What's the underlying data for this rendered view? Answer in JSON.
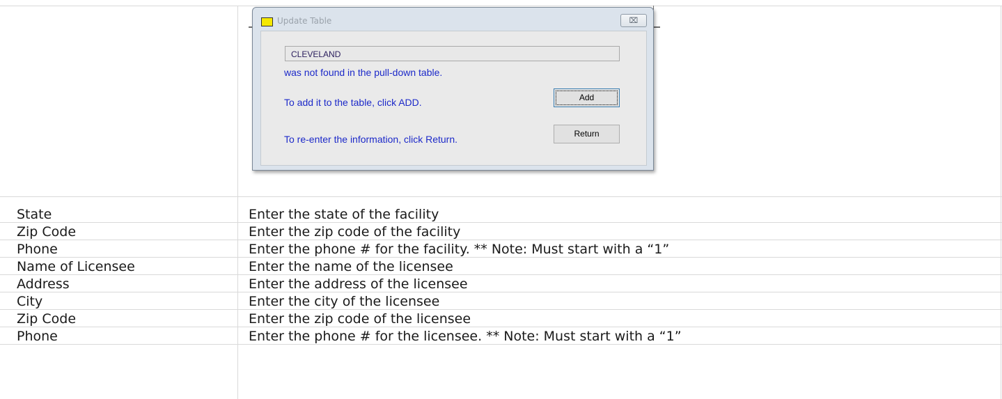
{
  "dialog": {
    "title": "Update Table",
    "close_glyph": "⌧",
    "entered_value": "CLEVELAND",
    "not_found_text": "was not found in the pull-down table.",
    "add_instruction": "To add it to the table, click ADD.",
    "return_instruction": "To re-enter the information, click Return.",
    "add_label": "Add",
    "return_label": "Return",
    "icon": "folder-icon"
  },
  "table": {
    "rows": [
      {
        "field": "State",
        "description": "Enter the state of the facility"
      },
      {
        "field": "Zip Code",
        "description": "Enter the zip code of the facility"
      },
      {
        "field": "Phone",
        "description": "Enter the phone # for the facility.  ** Note:  Must start with a “1”"
      },
      {
        "field": "Name of Licensee",
        "description": "Enter the name of the licensee"
      },
      {
        "field": "Address",
        "description": "Enter the address of the licensee"
      },
      {
        "field": "City",
        "description": "Enter the city of the licensee"
      },
      {
        "field": "Zip Code",
        "description": "Enter the zip code of the licensee"
      },
      {
        "field": "Phone",
        "description": "Enter the phone # for the licensee.  ** Note:  Must start with a “1”"
      }
    ]
  }
}
